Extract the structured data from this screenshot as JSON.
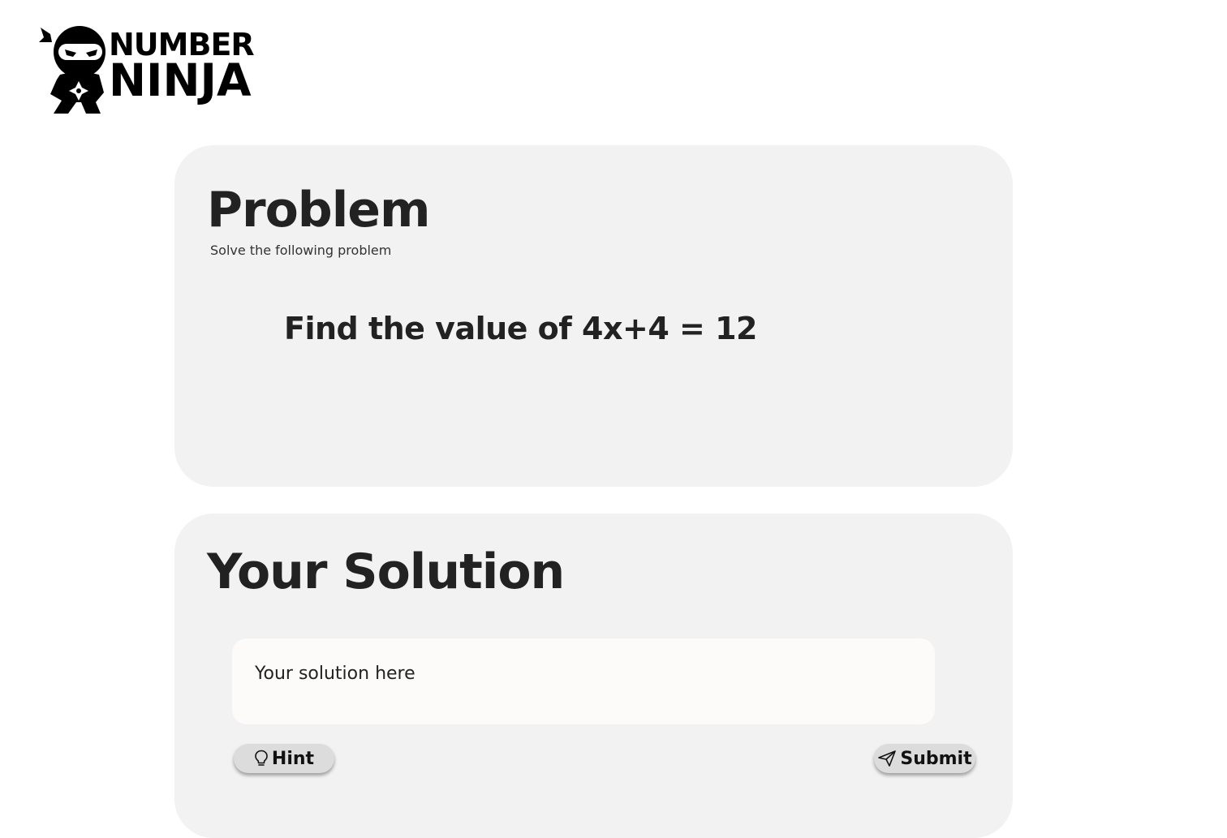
{
  "brand": {
    "line1": "NUMBER",
    "line2": "NINJA",
    "logo_icon": "ninja-mascot-icon"
  },
  "problem": {
    "title": "Problem",
    "subtitle": "Solve the following problem",
    "question": "Find the value of 4x+4 = 12"
  },
  "solution": {
    "title": "Your Solution",
    "input_value": "",
    "input_placeholder": "Your solution here",
    "hint_label": "Hint",
    "hint_icon": "lightbulb-icon",
    "submit_label": "Submit",
    "submit_icon": "send-icon"
  },
  "colors": {
    "card_background": "#f2f2f2",
    "input_background": "#fcfbfa",
    "button_background": "#dcdcdc",
    "text": "#222222"
  }
}
